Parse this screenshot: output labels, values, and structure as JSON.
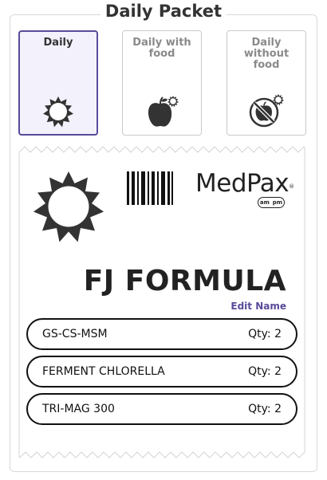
{
  "header": {
    "title": "Daily Packet"
  },
  "options": [
    {
      "label": "Daily",
      "icon": "sun-icon",
      "selected": true
    },
    {
      "label": "Daily with food",
      "icon": "apple-with-sun-icon",
      "selected": false
    },
    {
      "label": "Daily without food",
      "icon": "no-food-with-sun-icon",
      "selected": false
    }
  ],
  "packet": {
    "brand": "MedPax",
    "brand_mark": "®",
    "ampm": [
      "am",
      "pm"
    ],
    "formula_name": "FJ FORMULA",
    "edit_label": "Edit Name",
    "items": [
      {
        "name": "GS-CS-MSM",
        "qty": "Qty: 2"
      },
      {
        "name": "FERMENT CHLORELLA",
        "qty": "Qty: 2"
      },
      {
        "name": "TRI-MAG 300",
        "qty": "Qty: 2"
      }
    ]
  },
  "colors": {
    "accent": "#5a4a9a",
    "selected_bg": "#f3f1fc",
    "icon": "#333333"
  }
}
